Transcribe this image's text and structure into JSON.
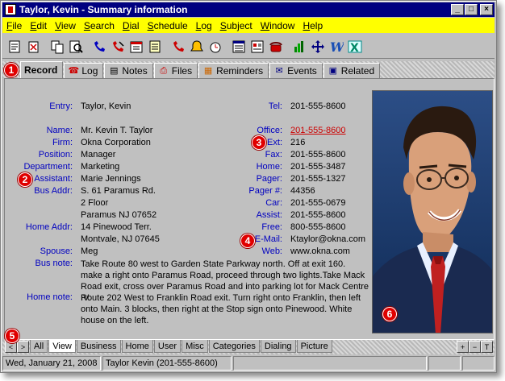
{
  "window": {
    "title": "Taylor, Kevin - Summary information",
    "controls": [
      "_",
      "□",
      "×"
    ]
  },
  "menu": [
    {
      "key": "F",
      "rest": "ile"
    },
    {
      "key": "E",
      "rest": "dit"
    },
    {
      "key": "V",
      "rest": "iew"
    },
    {
      "key": "S",
      "rest": "earch"
    },
    {
      "key": "D",
      "rest": "ial"
    },
    {
      "key": "S",
      "rest": "chedule"
    },
    {
      "key": "L",
      "rest": "og"
    },
    {
      "key": "S",
      "rest": "ubject"
    },
    {
      "key": "W",
      "rest": "indow"
    },
    {
      "key": "H",
      "rest": "elp"
    }
  ],
  "toolbar_icons": [
    "new-record-icon",
    "delete-record-icon",
    "copy-icon",
    "preview-icon",
    "dial-icon",
    "hangup-icon",
    "schedule-icon",
    "note-icon",
    "call-log-icon",
    "reminder-icon",
    "timer-icon",
    "list-icon",
    "form-icon",
    "phone-icon",
    "chart-icon",
    "move-icon",
    "word-icon",
    "excel-icon"
  ],
  "tabs_top": [
    {
      "label": "Record",
      "active": true
    },
    {
      "label": "Log"
    },
    {
      "label": "Notes"
    },
    {
      "label": "Files"
    },
    {
      "label": "Reminders"
    },
    {
      "label": "Events"
    },
    {
      "label": "Related"
    }
  ],
  "record": {
    "entry_label": "Entry:",
    "entry": "Taylor, Kevin",
    "name_label": "Name:",
    "name": "Mr. Kevin T. Taylor",
    "firm_label": "Firm:",
    "firm": "Okna Corporation",
    "position_label": "Position:",
    "position": "Manager",
    "department_label": "Department:",
    "department": "Marketing",
    "assistant_label": "Assistant:",
    "assistant": "Marie Jennings",
    "bus_addr_label": "Bus Addr:",
    "bus_addr_1": "S. 61 Paramus Rd.",
    "bus_addr_2": "2 Floor",
    "bus_addr_3": "Paramus NJ  07652",
    "home_addr_label": "Home Addr:",
    "home_addr_1": "14 Pinewood Terr.",
    "home_addr_2": "Montvale, NJ 07645",
    "spouse_label": "Spouse:",
    "spouse": "Meg",
    "bus_note_label": "Bus note:",
    "bus_note": "Take Route 80 west to Garden State Parkway north. Off at exit 160. make a right onto Paramus Road, proceed through two lights.Take Mack Road exit, cross over Paramus Road and into parking lot for Mack Centre IV.",
    "home_note_label": "Home note:",
    "home_note": "Route 202 West to Franklin Road exit. Turn right onto Franklin, then left onto Main.  3 blocks, then right at the Stop sign onto Pinewood.  White house on the left.",
    "tel_label": "Tel:",
    "tel": "201-555-8600",
    "office_label": "Office:",
    "office": "201-555-8600",
    "ext_label": "Ext:",
    "ext": "216",
    "fax_label": "Fax:",
    "fax": "201-555-8600",
    "home_label": "Home:",
    "home": "201-555-3487",
    "pager_label": "Pager:",
    "pager": "201-555-1327",
    "pager_num_label": "Pager #:",
    "pager_num": "44356",
    "car_label": "Car:",
    "car": "201-555-0679",
    "assist_label": "Assist:",
    "assist": "201-555-8600",
    "free_label": "Free:",
    "free": "800-555-8600",
    "email_label": "E-Mail:",
    "email": "Ktaylor@okna.com",
    "web_label": "Web:",
    "web": "www.okna.com"
  },
  "badges": [
    "1",
    "2",
    "3",
    "4",
    "5",
    "6"
  ],
  "tabs_bottom": [
    "All",
    "View",
    "Business",
    "Home",
    "User",
    "Misc",
    "Categories",
    "Dialing",
    "Picture"
  ],
  "bottom_active": "View",
  "nav": {
    "prev": "<",
    "next": ">",
    "plus": "+",
    "minus": "−",
    "pin": "T"
  },
  "status": {
    "date": "Wed, January 21, 2008",
    "contact": "Taylor Kevin (201-555-8600)"
  },
  "colors": {
    "title_bg": "#000080",
    "menu_bg": "#ffff00",
    "label": "#0000c0",
    "link": "#cc0000",
    "badge": "#e00000"
  }
}
